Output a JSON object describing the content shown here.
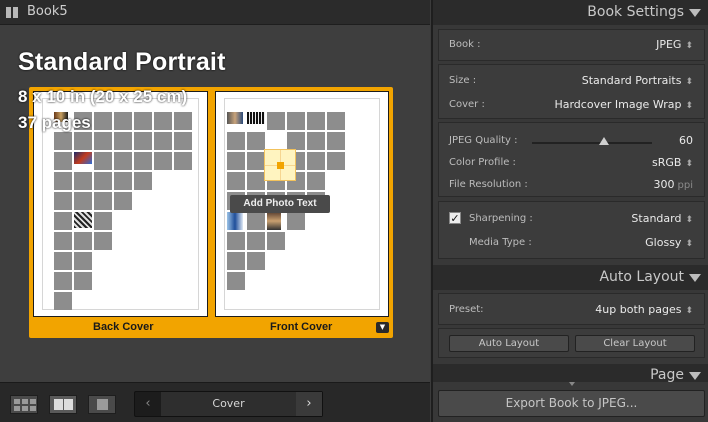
{
  "left": {
    "book_name": "Book5",
    "title": "Standard Portrait",
    "size_info": "8 x 10 in (20 x 25 cm)",
    "pages_info": "37 pages",
    "back_cover_label": "Back Cover",
    "front_cover_label": "Front Cover",
    "add_photo_text": "Add Photo Text"
  },
  "toolbar": {
    "nav_prev": "‹",
    "nav_label": "Cover",
    "nav_next": "›"
  },
  "book_settings": {
    "title": "Book Settings",
    "book_label": "Book :",
    "book_value": "JPEG",
    "size_label": "Size :",
    "size_value": "Standard Portraits",
    "cover_label": "Cover :",
    "cover_value": "Hardcover Image Wrap",
    "jpeg_quality_label": "JPEG Quality :",
    "jpeg_quality_value": "60",
    "jpeg_quality_fraction": 0.6,
    "color_profile_label": "Color Profile :",
    "color_profile_value": "sRGB",
    "file_resolution_label": "File Resolution :",
    "file_resolution_value": "300",
    "file_resolution_unit": "ppi",
    "sharpening_label": "Sharpening :",
    "sharpening_checked": true,
    "sharpening_value": "Standard",
    "media_type_label": "Media Type :",
    "media_type_value": "Glossy"
  },
  "auto_layout": {
    "title": "Auto Layout",
    "preset_label": "Preset:",
    "preset_value": "4up both pages",
    "auto_layout_button": "Auto Layout",
    "clear_layout_button": "Clear Layout"
  },
  "page_section": {
    "title": "Page"
  },
  "export_button": "Export Book to JPEG...",
  "colors": {
    "accent": "#f2a400",
    "panel_bg": "#383838",
    "header_bg": "#2b2b2b"
  }
}
